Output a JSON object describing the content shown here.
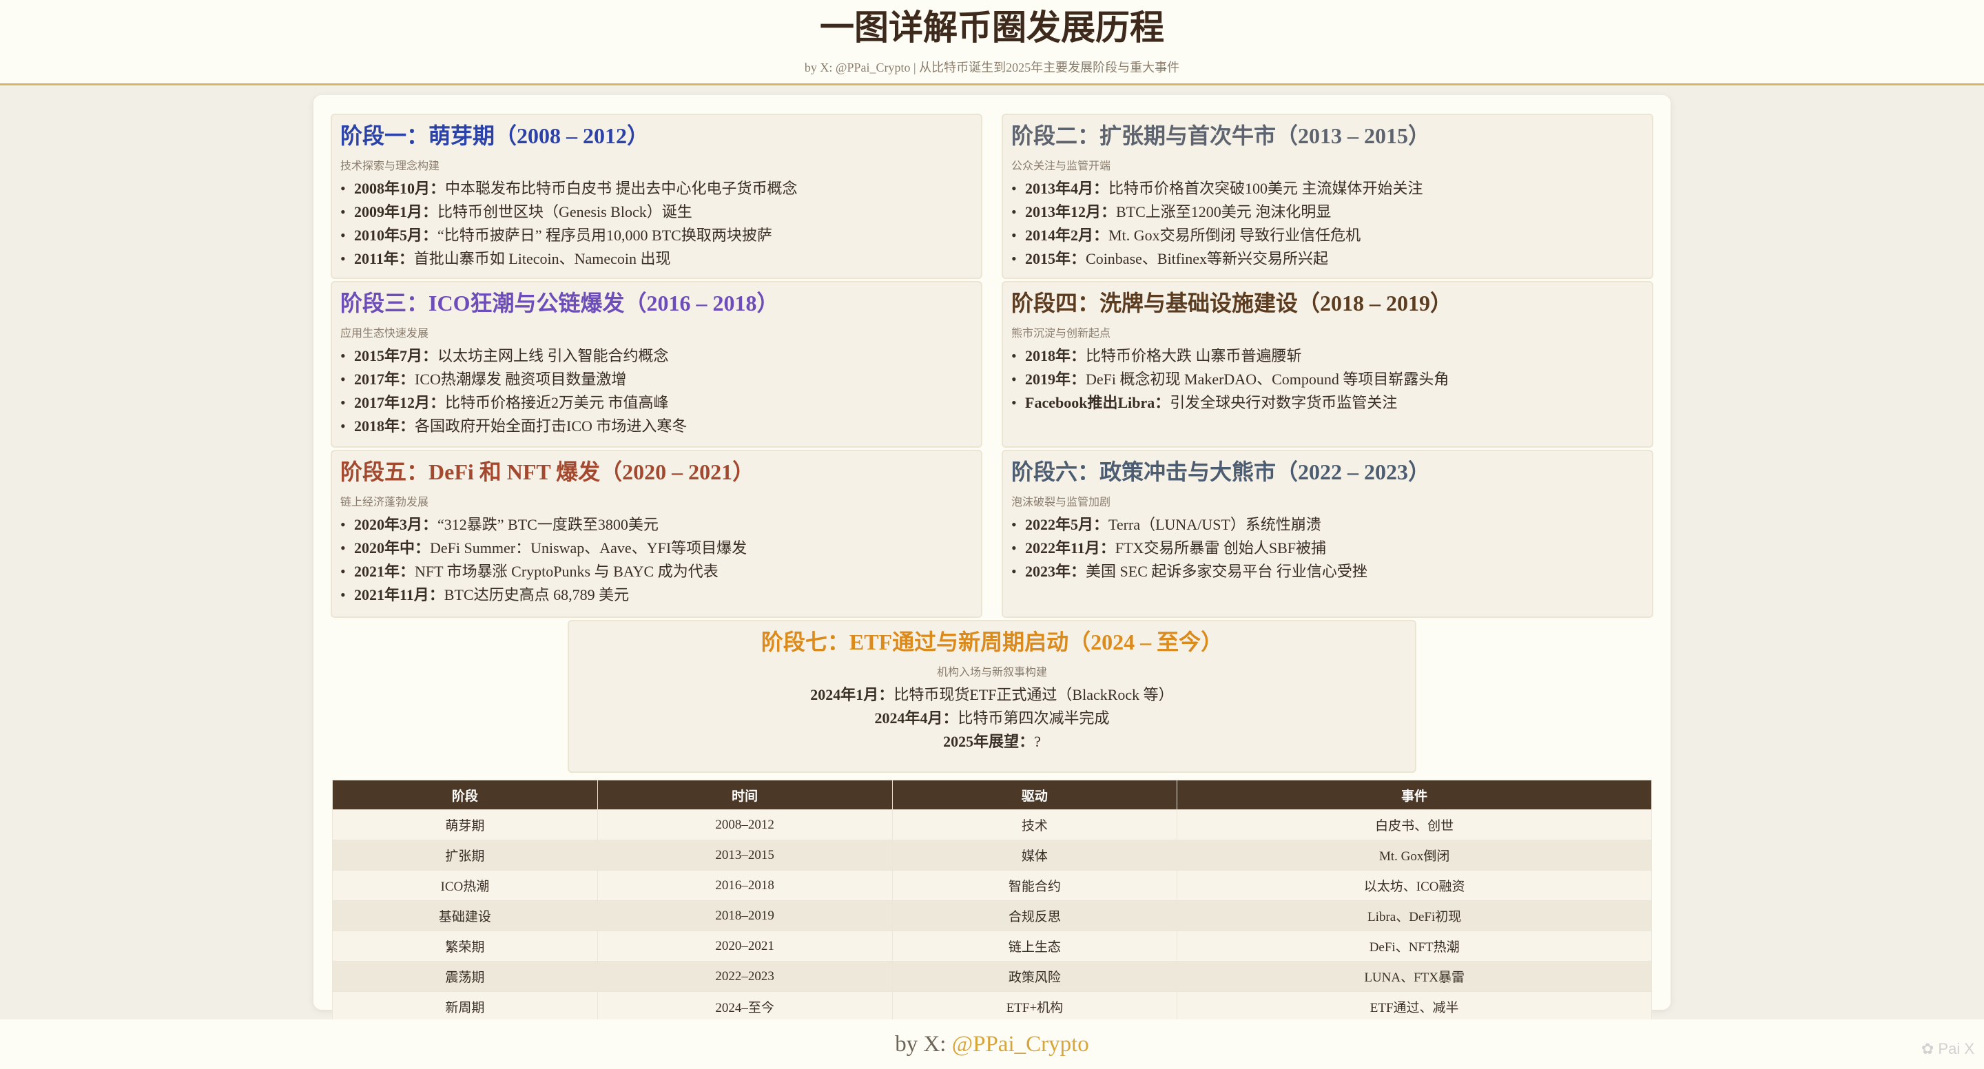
{
  "header": {
    "title": "一图详解币圈发展历程",
    "subtitle": "by X: @PPai_Crypto | 从比特币诞生到2025年主要发展阶段与重大事件"
  },
  "stages": [
    {
      "title": "阶段一：萌芽期（2008 – 2012）",
      "subtitle": "技术探索与理念构建",
      "events": [
        {
          "date": "2008年10月：",
          "text": "中本聪发布比特币白皮书 提出去中心化电子货币概念"
        },
        {
          "date": "2009年1月：",
          "text": "比特币创世区块（Genesis Block）诞生"
        },
        {
          "date": "2010年5月：",
          "text": "“比特币披萨日” 程序员用10,000 BTC换取两块披萨"
        },
        {
          "date": "2011年：",
          "text": "首批山寨币如 Litecoin、Namecoin 出现"
        }
      ]
    },
    {
      "title": "阶段二：扩张期与首次牛市（2013 – 2015）",
      "subtitle": "公众关注与监管开端",
      "events": [
        {
          "date": "2013年4月：",
          "text": "比特币价格首次突破100美元 主流媒体开始关注"
        },
        {
          "date": "2013年12月：",
          "text": "BTC上涨至1200美元 泡沫化明显"
        },
        {
          "date": "2014年2月：",
          "text": "Mt. Gox交易所倒闭 导致行业信任危机"
        },
        {
          "date": "2015年：",
          "text": "Coinbase、Bitfinex等新兴交易所兴起"
        }
      ]
    },
    {
      "title": "阶段三：ICO狂潮与公链爆发（2016 – 2018）",
      "subtitle": "应用生态快速发展",
      "events": [
        {
          "date": "2015年7月：",
          "text": "以太坊主网上线 引入智能合约概念"
        },
        {
          "date": "2017年：",
          "text": "ICO热潮爆发 融资项目数量激增"
        },
        {
          "date": "2017年12月：",
          "text": "比特币价格接近2万美元 市值高峰"
        },
        {
          "date": "2018年：",
          "text": "各国政府开始全面打击ICO 市场进入寒冬"
        }
      ]
    },
    {
      "title": "阶段四：洗牌与基础设施建设（2018 – 2019）",
      "subtitle": "熊市沉淀与创新起点",
      "events": [
        {
          "date": "2018年：",
          "text": "比特币价格大跌 山寨币普遍腰斩"
        },
        {
          "date": "2019年：",
          "text": "DeFi 概念初现 MakerDAO、Compound 等项目崭露头角"
        },
        {
          "date": "Facebook推出Libra：",
          "text": "引发全球央行对数字货币监管关注"
        }
      ]
    },
    {
      "title": "阶段五：DeFi 和 NFT 爆发（2020 – 2021）",
      "subtitle": "链上经济蓬勃发展",
      "events": [
        {
          "date": "2020年3月：",
          "text": "“312暴跌” BTC一度跌至3800美元"
        },
        {
          "date": "2020年中：",
          "text": "DeFi Summer：Uniswap、Aave、YFI等项目爆发"
        },
        {
          "date": "2021年：",
          "text": "NFT 市场暴涨 CryptoPunks 与 BAYC 成为代表"
        },
        {
          "date": "2021年11月：",
          "text": "BTC达历史高点 68,789 美元"
        }
      ]
    },
    {
      "title": "阶段六：政策冲击与大熊市（2022 – 2023）",
      "subtitle": "泡沫破裂与监管加剧",
      "events": [
        {
          "date": "2022年5月：",
          "text": "Terra（LUNA/UST）系统性崩溃"
        },
        {
          "date": "2022年11月：",
          "text": "FTX交易所暴雷 创始人SBF被捕"
        },
        {
          "date": "2023年：",
          "text": "美国 SEC 起诉多家交易平台 行业信心受挫"
        }
      ]
    },
    {
      "title": "阶段七：ETF通过与新周期启动（2024 – 至今）",
      "subtitle": "机构入场与新叙事构建",
      "events": [
        {
          "date": "2024年1月：",
          "text": "比特币现货ETF正式通过（BlackRock 等）"
        },
        {
          "date": "2024年4月：",
          "text": "比特币第四次减半完成"
        },
        {
          "date": "2025年展望：",
          "text": "?"
        }
      ]
    }
  ],
  "table": {
    "headers": [
      "阶段",
      "时间",
      "驱动",
      "事件"
    ],
    "rows": [
      [
        "萌芽期",
        "2008–2012",
        "技术",
        "白皮书、创世"
      ],
      [
        "扩张期",
        "2013–2015",
        "媒体",
        "Mt. Gox倒闭"
      ],
      [
        "ICO热潮",
        "2016–2018",
        "智能合约",
        "以太坊、ICO融资"
      ],
      [
        "基础建设",
        "2018–2019",
        "合规反思",
        "Libra、DeFi初现"
      ],
      [
        "繁荣期",
        "2020–2021",
        "链上生态",
        "DeFi、NFT热潮"
      ],
      [
        "震荡期",
        "2022–2023",
        "政策风险",
        "LUNA、FTX暴雷"
      ],
      [
        "新周期",
        "2024–至今",
        "ETF+机构",
        "ETF通过、减半"
      ]
    ]
  },
  "footer": {
    "prefix": "by X: ",
    "handle": "@PPai_Crypto"
  },
  "watermark": "Pai X",
  "colors": {
    "stage1": "#2b43a8",
    "stage2": "#5d6470",
    "stage3": "#6d4dba",
    "stage4": "#5c3c20",
    "stage5": "#a2492f",
    "stage6": "#4c5d72",
    "stage7": "#db8a1c",
    "table_header": "#4c3826",
    "accent": "#d9b56a"
  }
}
